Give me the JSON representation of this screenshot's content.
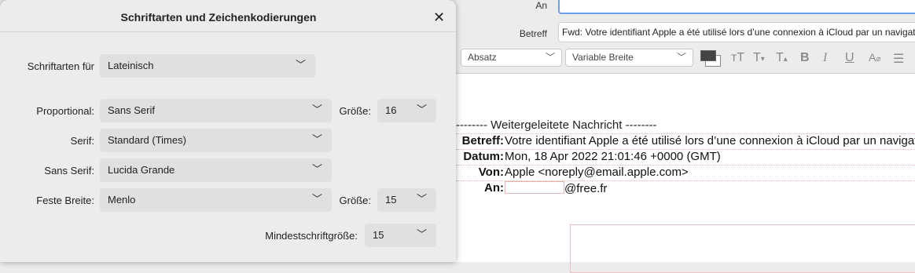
{
  "dialog": {
    "title": "Schriftarten und Zeichenkodierungen",
    "close_symbol": "✕",
    "fonts_for_label": "Schriftarten für",
    "fonts_for_value": "Lateinisch",
    "proportional_label": "Proportional:",
    "proportional_value": "Sans Serif",
    "size_label": "Größe:",
    "proportional_size": "16",
    "serif_label": "Serif:",
    "serif_value": "Standard (Times)",
    "sans_serif_label": "Sans Serif:",
    "sans_serif_value": "Lucida Grande",
    "monospace_label": "Feste Breite:",
    "monospace_value": "Menlo",
    "monospace_size": "15",
    "min_size_label": "Mindestschriftgröße:",
    "min_size_value": "15"
  },
  "composer": {
    "to_label": "An",
    "subject_label": "Betreff",
    "subject_value": "Fwd: Votre identifiant Apple a été utilisé lors d’une connexion à iCloud par un navigateur web",
    "paragraph_style": "Absatz",
    "font_style": "Variable Breite",
    "toolbar_icons": [
      "text-color-icon",
      "font-size-icon",
      "decrease-size-icon",
      "increase-size-icon",
      "bold-icon",
      "italic-icon",
      "underline-icon",
      "clear-format-icon",
      "list-icon"
    ],
    "forwarded_title": "-------- Weitergeleitete Nachricht --------",
    "headers": [
      {
        "key": "Betreff:",
        "value": "Votre identifiant Apple a été utilisé lors d’une connexion à iCloud par un navigateur web"
      },
      {
        "key": "Datum:",
        "value": "Mon, 18 Apr 2022 21:01:46 +0000 (GMT)"
      },
      {
        "key": "Von:",
        "value": "Apple <noreply@email.apple.com>"
      },
      {
        "key": "An:",
        "value": "@free.fr"
      }
    ]
  }
}
